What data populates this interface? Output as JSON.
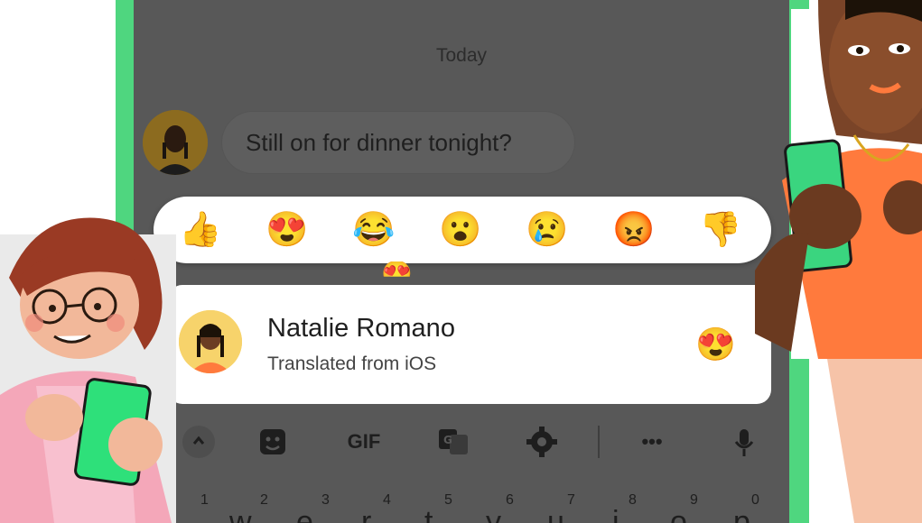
{
  "chat": {
    "date_label": "Today",
    "message_text": "Still on for dinner tonight?"
  },
  "reactions": [
    {
      "name": "thumbs-up",
      "glyph": "👍"
    },
    {
      "name": "heart-eyes",
      "glyph": "😍"
    },
    {
      "name": "tears-of-joy",
      "glyph": "😂"
    },
    {
      "name": "surprised",
      "glyph": "😮"
    },
    {
      "name": "crying",
      "glyph": "😢"
    },
    {
      "name": "angry",
      "glyph": "😡"
    },
    {
      "name": "thumbs-down",
      "glyph": "👎"
    }
  ],
  "floating_reaction": "😍",
  "notification": {
    "name": "Natalie Romano",
    "subtitle": "Translated from iOS",
    "reaction": "😍"
  },
  "keyboard": {
    "toolbar": [
      {
        "name": "sticker-icon"
      },
      {
        "name": "gif-button",
        "label": "GIF"
      },
      {
        "name": "translate-icon"
      },
      {
        "name": "settings-icon"
      },
      {
        "name": "more-icon",
        "label": "•••"
      },
      {
        "name": "microphone-icon"
      }
    ],
    "number_row": [
      "1",
      "2",
      "3",
      "4",
      "5",
      "6",
      "7",
      "8",
      "9",
      "0"
    ],
    "letter_row": [
      "w",
      "e",
      "r",
      "t",
      "y",
      "u",
      "i",
      "o",
      "p"
    ]
  },
  "colors": {
    "phone_frame": "#4fd67f",
    "screen_dim": "#585858",
    "card": "#ffffff",
    "accent_orange": "#ff7a3d"
  }
}
